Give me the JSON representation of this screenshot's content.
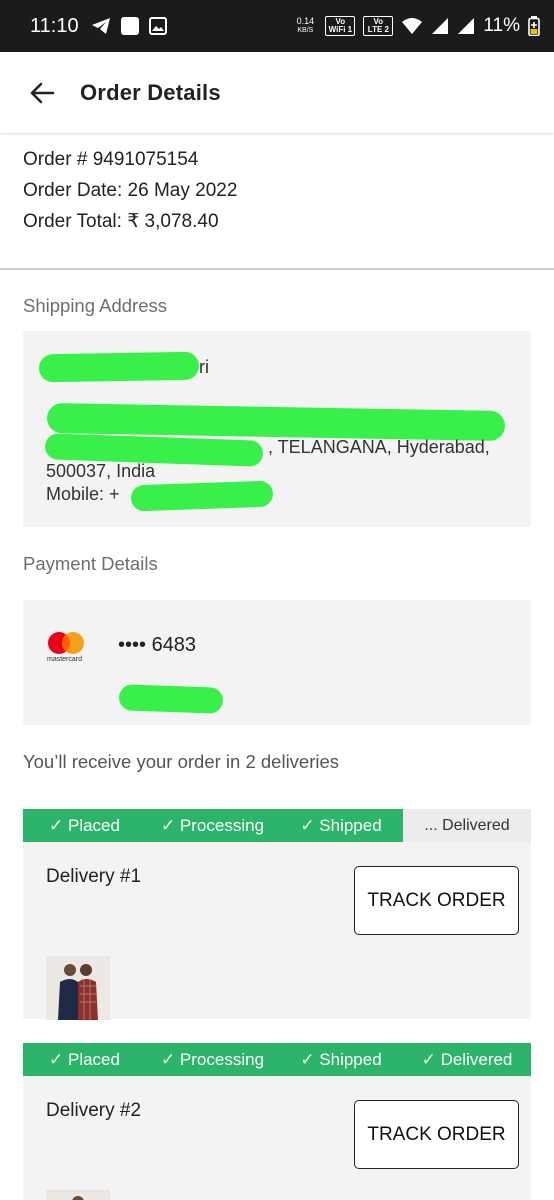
{
  "status_bar": {
    "time": "11:10",
    "net_speed": "0.14",
    "net_unit": "KB/S",
    "badge_1": "Vo WiFi 1",
    "badge_2": "Vo LTE 2",
    "battery": "11%"
  },
  "header": {
    "title": "Order Details",
    "back_icon": "arrow-left-icon"
  },
  "order": {
    "number": "Order # 9491075154",
    "date": "Order Date: 26 May 2022",
    "total": "Order Total: ₹ 3,078.40"
  },
  "shipping": {
    "label": "Shipping Address",
    "name_tail": "ri",
    "line_state": ", TELANGANA, Hyderabad,",
    "line_pin": "500037, India",
    "mobile": "Mobile: +"
  },
  "payment": {
    "label": "Payment Details",
    "card_brand": "mastercard",
    "card_masked": "•••• 6483"
  },
  "deliveries_info": "You’ll receive your order in 2 deliveries",
  "deliveries": [
    {
      "title": "Delivery #1",
      "track_label": "TRACK ORDER",
      "steps": [
        "✓ Placed",
        "✓ Processing",
        "✓ Shipped",
        "... Delivered"
      ]
    },
    {
      "title": "Delivery #2",
      "track_label": "TRACK ORDER",
      "steps": [
        "✓ Placed",
        "✓ Processing",
        "✓ Shipped",
        "✓ Delivered"
      ]
    }
  ],
  "colors": {
    "progress_green": "#2cb56a",
    "card_bg": "#f3f3f3",
    "redaction": "#39f04a"
  }
}
